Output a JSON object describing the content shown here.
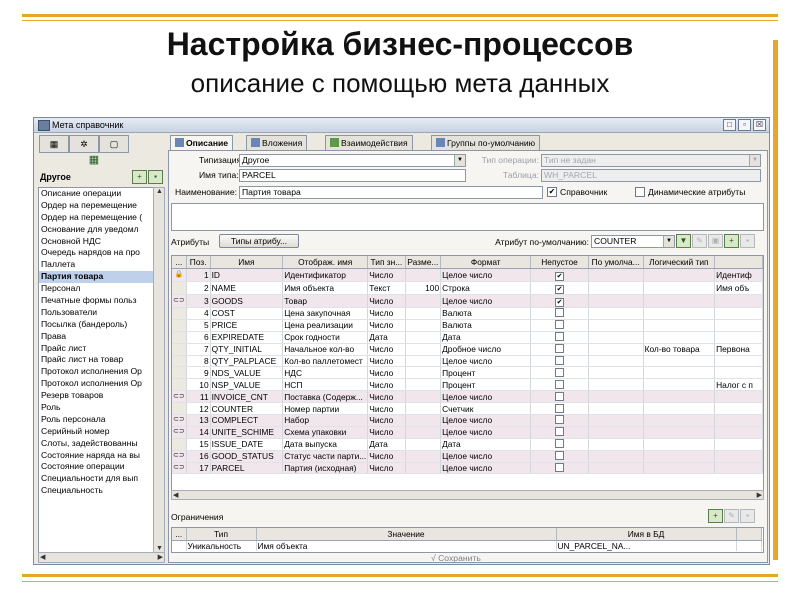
{
  "slide": {
    "title": "Настройка бизнес-процессов",
    "subtitle": "описание с помощью мета данных"
  },
  "window": {
    "title": "Мета справочник",
    "controls": [
      "□",
      "▫",
      "☒"
    ]
  },
  "left_panel": {
    "combo_label": "Другое",
    "items": [
      "Описание операции",
      "Ордер на перемещение",
      "Ордер на перемещение (",
      "Основание для уведомл",
      "Основной НДС",
      "Очередь нарядов на про",
      "Паллета",
      "Партия товара",
      "Персонал",
      "Печатные формы польз",
      "Пользователи",
      "Посылка (бандероль)",
      "Права",
      "Прайс лист",
      "Прайс лист на товар",
      "Протокол исполнения Ор",
      "Протокол исполнения Ор",
      "Резерв товаров",
      "Роль",
      "Роль персонала",
      "Серийный номер",
      "Слоты, задействованны",
      "Состояние наряда на вы",
      "Состояние операции",
      "Специальности для вып",
      "Специальность"
    ],
    "selected_index": 7
  },
  "tabs": [
    "Описание",
    "Вложения",
    "Взаимодействия",
    "Группы по-умолчанию"
  ],
  "form": {
    "typization_label": "Типизация:",
    "typization_value": "Другое",
    "operation_type_label": "Тип операции:",
    "operation_type_value": "Тип не задан",
    "type_name_label": "Имя типа:",
    "type_name_value": "PARCEL",
    "table_label": "Таблица:",
    "table_value": "WH_PARCEL",
    "name_label": "Наименование:",
    "name_value": "Партия товара",
    "reference_label": "Справочник",
    "dynamic_attrs_label": "Динамические атрибуты",
    "attrs_label": "Атрибуты",
    "attr_types_button": "Типы атрибу...",
    "default_attr_label": "Атрибут по-умолчанию:",
    "default_attr_value": "COUNTER"
  },
  "attributes_table": {
    "columns": [
      "...",
      "Поз.",
      "Имя",
      "Отображ. имя",
      "Тип зн...",
      "Разме...",
      "Формат",
      "Непустое",
      "По умолча...",
      "Логический тип",
      ""
    ],
    "rows": [
      {
        "icon": "lock",
        "pos": "1",
        "name": "ID",
        "display": "Идентификатор",
        "type": "Число",
        "size": "",
        "format": "Целое число",
        "notnull": true,
        "default": "",
        "logic": "",
        "extra": "Идентиф",
        "pk": true
      },
      {
        "icon": "",
        "pos": "2",
        "name": "NAME",
        "display": "Имя объекта",
        "type": "Текст",
        "size": "100",
        "format": "Строка",
        "notnull": true,
        "default": "",
        "logic": "",
        "extra": "Имя объ",
        "pk": false
      },
      {
        "icon": "link",
        "pos": "3",
        "name": "GOODS",
        "display": "Товар",
        "type": "Число",
        "size": "",
        "format": "Целое число",
        "notnull": true,
        "default": "",
        "logic": "",
        "extra": "",
        "pk": true
      },
      {
        "icon": "",
        "pos": "4",
        "name": "COST",
        "display": "Цена закупочная",
        "type": "Число",
        "size": "",
        "format": "Валюта",
        "notnull": false,
        "default": "",
        "logic": "",
        "extra": "",
        "pk": false
      },
      {
        "icon": "",
        "pos": "5",
        "name": "PRICE",
        "display": "Цена реализации",
        "type": "Число",
        "size": "",
        "format": "Валюта",
        "notnull": false,
        "default": "",
        "logic": "",
        "extra": "",
        "pk": false
      },
      {
        "icon": "",
        "pos": "6",
        "name": "EXPIREDATE",
        "display": "Срок годности",
        "type": "Дата",
        "size": "",
        "format": "Дата",
        "notnull": false,
        "default": "",
        "logic": "",
        "extra": "",
        "pk": false
      },
      {
        "icon": "",
        "pos": "7",
        "name": "QTY_INITIAL",
        "display": "Начальное кол-во",
        "type": "Число",
        "size": "",
        "format": "Дробное число",
        "notnull": false,
        "default": "",
        "logic": "Кол-во товара",
        "extra": "Первона",
        "pk": false
      },
      {
        "icon": "",
        "pos": "8",
        "name": "QTY_PALPLACE",
        "display": "Кол-во паллетомест",
        "type": "Число",
        "size": "",
        "format": "Целое число",
        "notnull": false,
        "default": "",
        "logic": "",
        "extra": "",
        "pk": false
      },
      {
        "icon": "",
        "pos": "9",
        "name": "NDS_VALUE",
        "display": "НДС",
        "type": "Число",
        "size": "",
        "format": "Процент",
        "notnull": false,
        "default": "",
        "logic": "",
        "extra": "",
        "pk": false
      },
      {
        "icon": "",
        "pos": "10",
        "name": "NSP_VALUE",
        "display": "НСП",
        "type": "Число",
        "size": "",
        "format": "Процент",
        "notnull": false,
        "default": "",
        "logic": "",
        "extra": "Налог с п",
        "pk": false
      },
      {
        "icon": "link",
        "pos": "11",
        "name": "INVOICE_CNT",
        "display": "Поставка (Содерж...",
        "type": "Число",
        "size": "",
        "format": "Целое число",
        "notnull": false,
        "default": "",
        "logic": "",
        "extra": "",
        "pk": true
      },
      {
        "icon": "",
        "pos": "12",
        "name": "COUNTER",
        "display": "Номер партии",
        "type": "Число",
        "size": "",
        "format": "Счетчик",
        "notnull": false,
        "default": "",
        "logic": "",
        "extra": "",
        "pk": false
      },
      {
        "icon": "link",
        "pos": "13",
        "name": "COMPLECT",
        "display": "Набор",
        "type": "Число",
        "size": "",
        "format": "Целое число",
        "notnull": false,
        "default": "",
        "logic": "",
        "extra": "",
        "pk": true
      },
      {
        "icon": "link",
        "pos": "14",
        "name": "UNITE_SCHIME",
        "display": "Схема упаковки",
        "type": "Число",
        "size": "",
        "format": "Целое число",
        "notnull": false,
        "default": "",
        "logic": "",
        "extra": "",
        "pk": true
      },
      {
        "icon": "",
        "pos": "15",
        "name": "ISSUE_DATE",
        "display": "Дата выпуска",
        "type": "Дата",
        "size": "",
        "format": "Дата",
        "notnull": false,
        "default": "",
        "logic": "",
        "extra": "",
        "pk": false
      },
      {
        "icon": "link",
        "pos": "16",
        "name": "GOOD_STATUS",
        "display": "Статус части парти...",
        "type": "Число",
        "size": "",
        "format": "Целое число",
        "notnull": false,
        "default": "",
        "logic": "",
        "extra": "",
        "pk": true
      },
      {
        "icon": "link",
        "pos": "17",
        "name": "PARCEL",
        "display": "Партия (исходная)",
        "type": "Число",
        "size": "",
        "format": "Целое число",
        "notnull": false,
        "default": "",
        "logic": "",
        "extra": "",
        "pk": true
      }
    ]
  },
  "constraints": {
    "label": "Ограничения",
    "columns": [
      "...",
      "Тип",
      "Значение",
      "Имя в БД",
      ""
    ],
    "rows": [
      {
        "type": "Уникальность",
        "value": "Имя объекта",
        "dbname": "UN_PARCEL_NA..."
      }
    ]
  },
  "save_button": "√  Сохранить",
  "colors": {
    "frame_accent": "#e8a62a",
    "selection": "#bfd0ea",
    "pk_row": "#f1e6ec"
  }
}
